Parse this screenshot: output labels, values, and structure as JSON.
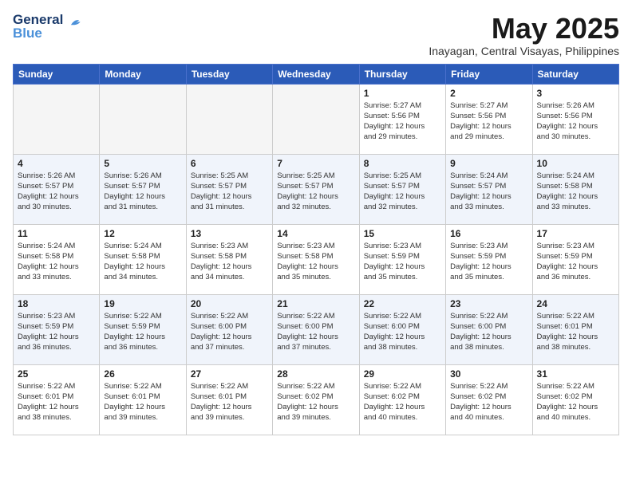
{
  "header": {
    "logo_line1": "General",
    "logo_line2": "Blue",
    "month": "May 2025",
    "location": "Inayagan, Central Visayas, Philippines"
  },
  "weekdays": [
    "Sunday",
    "Monday",
    "Tuesday",
    "Wednesday",
    "Thursday",
    "Friday",
    "Saturday"
  ],
  "weeks": [
    [
      {
        "day": "",
        "info": ""
      },
      {
        "day": "",
        "info": ""
      },
      {
        "day": "",
        "info": ""
      },
      {
        "day": "",
        "info": ""
      },
      {
        "day": "1",
        "info": "Sunrise: 5:27 AM\nSunset: 5:56 PM\nDaylight: 12 hours\nand 29 minutes."
      },
      {
        "day": "2",
        "info": "Sunrise: 5:27 AM\nSunset: 5:56 PM\nDaylight: 12 hours\nand 29 minutes."
      },
      {
        "day": "3",
        "info": "Sunrise: 5:26 AM\nSunset: 5:56 PM\nDaylight: 12 hours\nand 30 minutes."
      }
    ],
    [
      {
        "day": "4",
        "info": "Sunrise: 5:26 AM\nSunset: 5:57 PM\nDaylight: 12 hours\nand 30 minutes."
      },
      {
        "day": "5",
        "info": "Sunrise: 5:26 AM\nSunset: 5:57 PM\nDaylight: 12 hours\nand 31 minutes."
      },
      {
        "day": "6",
        "info": "Sunrise: 5:25 AM\nSunset: 5:57 PM\nDaylight: 12 hours\nand 31 minutes."
      },
      {
        "day": "7",
        "info": "Sunrise: 5:25 AM\nSunset: 5:57 PM\nDaylight: 12 hours\nand 32 minutes."
      },
      {
        "day": "8",
        "info": "Sunrise: 5:25 AM\nSunset: 5:57 PM\nDaylight: 12 hours\nand 32 minutes."
      },
      {
        "day": "9",
        "info": "Sunrise: 5:24 AM\nSunset: 5:57 PM\nDaylight: 12 hours\nand 33 minutes."
      },
      {
        "day": "10",
        "info": "Sunrise: 5:24 AM\nSunset: 5:58 PM\nDaylight: 12 hours\nand 33 minutes."
      }
    ],
    [
      {
        "day": "11",
        "info": "Sunrise: 5:24 AM\nSunset: 5:58 PM\nDaylight: 12 hours\nand 33 minutes."
      },
      {
        "day": "12",
        "info": "Sunrise: 5:24 AM\nSunset: 5:58 PM\nDaylight: 12 hours\nand 34 minutes."
      },
      {
        "day": "13",
        "info": "Sunrise: 5:23 AM\nSunset: 5:58 PM\nDaylight: 12 hours\nand 34 minutes."
      },
      {
        "day": "14",
        "info": "Sunrise: 5:23 AM\nSunset: 5:58 PM\nDaylight: 12 hours\nand 35 minutes."
      },
      {
        "day": "15",
        "info": "Sunrise: 5:23 AM\nSunset: 5:59 PM\nDaylight: 12 hours\nand 35 minutes."
      },
      {
        "day": "16",
        "info": "Sunrise: 5:23 AM\nSunset: 5:59 PM\nDaylight: 12 hours\nand 35 minutes."
      },
      {
        "day": "17",
        "info": "Sunrise: 5:23 AM\nSunset: 5:59 PM\nDaylight: 12 hours\nand 36 minutes."
      }
    ],
    [
      {
        "day": "18",
        "info": "Sunrise: 5:23 AM\nSunset: 5:59 PM\nDaylight: 12 hours\nand 36 minutes."
      },
      {
        "day": "19",
        "info": "Sunrise: 5:22 AM\nSunset: 5:59 PM\nDaylight: 12 hours\nand 36 minutes."
      },
      {
        "day": "20",
        "info": "Sunrise: 5:22 AM\nSunset: 6:00 PM\nDaylight: 12 hours\nand 37 minutes."
      },
      {
        "day": "21",
        "info": "Sunrise: 5:22 AM\nSunset: 6:00 PM\nDaylight: 12 hours\nand 37 minutes."
      },
      {
        "day": "22",
        "info": "Sunrise: 5:22 AM\nSunset: 6:00 PM\nDaylight: 12 hours\nand 38 minutes."
      },
      {
        "day": "23",
        "info": "Sunrise: 5:22 AM\nSunset: 6:00 PM\nDaylight: 12 hours\nand 38 minutes."
      },
      {
        "day": "24",
        "info": "Sunrise: 5:22 AM\nSunset: 6:01 PM\nDaylight: 12 hours\nand 38 minutes."
      }
    ],
    [
      {
        "day": "25",
        "info": "Sunrise: 5:22 AM\nSunset: 6:01 PM\nDaylight: 12 hours\nand 38 minutes."
      },
      {
        "day": "26",
        "info": "Sunrise: 5:22 AM\nSunset: 6:01 PM\nDaylight: 12 hours\nand 39 minutes."
      },
      {
        "day": "27",
        "info": "Sunrise: 5:22 AM\nSunset: 6:01 PM\nDaylight: 12 hours\nand 39 minutes."
      },
      {
        "day": "28",
        "info": "Sunrise: 5:22 AM\nSunset: 6:02 PM\nDaylight: 12 hours\nand 39 minutes."
      },
      {
        "day": "29",
        "info": "Sunrise: 5:22 AM\nSunset: 6:02 PM\nDaylight: 12 hours\nand 40 minutes."
      },
      {
        "day": "30",
        "info": "Sunrise: 5:22 AM\nSunset: 6:02 PM\nDaylight: 12 hours\nand 40 minutes."
      },
      {
        "day": "31",
        "info": "Sunrise: 5:22 AM\nSunset: 6:02 PM\nDaylight: 12 hours\nand 40 minutes."
      }
    ]
  ]
}
